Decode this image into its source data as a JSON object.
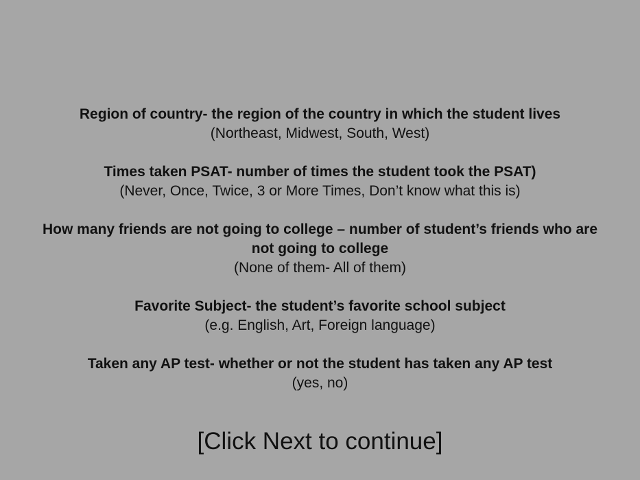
{
  "items": [
    {
      "title": "Region of country- the region of the country in which the student lives",
      "desc": "(Northeast, Midwest, South, West)"
    },
    {
      "title": "Times taken PSAT- number of times the student took the PSAT)",
      "desc": "(Never, Once, Twice, 3 or More Times, Don’t know what this is)"
    },
    {
      "title": "How many friends are not going to college – number of student’s friends who are not going to college",
      "desc": "(None of them- All of them)"
    },
    {
      "title": "Favorite Subject- the student’s favorite school subject",
      "desc": "(e.g. English, Art, Foreign language)"
    },
    {
      "title": "Taken any AP test- whether or not the student has taken any AP test",
      "desc": "(yes, no)"
    }
  ],
  "continue_prompt": "[Click Next to continue]"
}
